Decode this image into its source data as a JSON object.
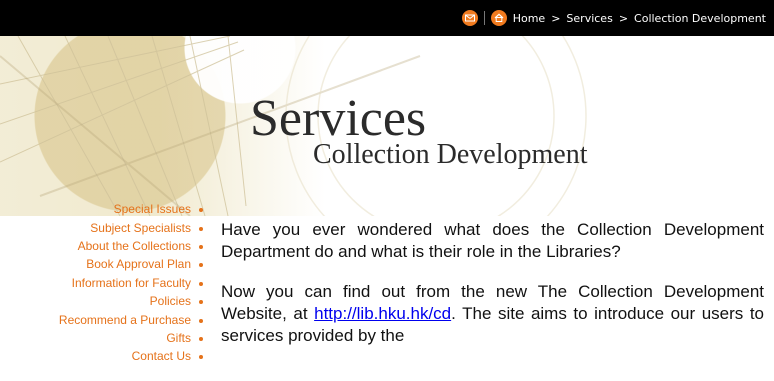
{
  "header": {
    "breadcrumb": {
      "home": "Home",
      "separator": ">",
      "services": "Services",
      "current": "Collection Development"
    },
    "icons": {
      "mail": "mail-icon",
      "home": "home-icon"
    },
    "colors": {
      "topbar_bg": "#000000",
      "icon_bg": "#f07a1e"
    }
  },
  "title": {
    "main": "Services",
    "sub": "Collection Development"
  },
  "sidebar": {
    "items": [
      {
        "label": "Special Issues"
      },
      {
        "label": "Subject Specialists"
      },
      {
        "label": "About the Collections"
      },
      {
        "label": "Book Approval Plan"
      },
      {
        "label": "Information for Faculty"
      },
      {
        "label": "Policies"
      },
      {
        "label": "Recommend a Purchase"
      },
      {
        "label": "Gifts"
      },
      {
        "label": "Contact Us"
      }
    ],
    "accent_color": "#e5721a"
  },
  "content": {
    "paragraph1": "Have you ever wondered what does the Collection Development Department do and what is their role in the Libraries?",
    "paragraph2": {
      "prefix": "Now you can find out from the new The Collection Development Website, at ",
      "link": "http://lib.hku.hk/cd",
      "suffix": ". The site aims to introduce our users to services provided by the"
    }
  }
}
